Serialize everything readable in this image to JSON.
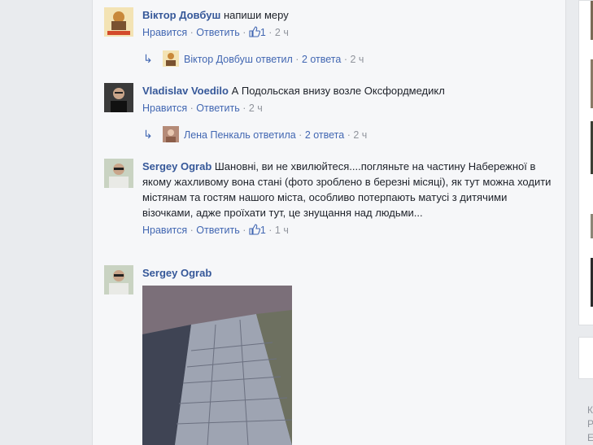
{
  "comments": [
    {
      "author": "Віктор Довбуш",
      "text": "напиши меру",
      "like_label": "Нравится",
      "reply_label": "Ответить",
      "likes": "1",
      "time": "2 ч",
      "replies": {
        "text": "Віктор Довбуш ответил",
        "count": "2 ответа",
        "time": "2 ч"
      }
    },
    {
      "author": "Vladislav Voedilo",
      "text": "А Подольская внизу возле Оксфордмедикл",
      "like_label": "Нравится",
      "reply_label": "Ответить",
      "time": "2 ч",
      "replies": {
        "text": "Лена Пенкаль ответила",
        "count": "2 ответа",
        "time": "2 ч"
      }
    },
    {
      "author": "Sergey Ograb",
      "text": "Шановні, ви не хвилюйтеся....погляньте на частину Набережної в якому жахливому вона стані (фото зроблено в березні місяці), як тут можна ходити містянам та гостям нашого міста, особливо потерпають матусі з дитячими візочками, адже проїхати тут, це знущання над людьми...",
      "like_label": "Нравится",
      "reply_label": "Ответить",
      "likes": "1",
      "time": "1 ч"
    },
    {
      "author": "Sergey Ograb"
    }
  ],
  "icons": {
    "like": "thumbs-up-icon",
    "reply_arrow": "reply-arrow-icon"
  },
  "colors": {
    "link": "#365899",
    "action": "#4267b2",
    "meta": "#90949c",
    "bg": "#f6f7f9"
  },
  "right_column": {
    "lines": [
      "К",
      "Р",
      "Е"
    ]
  }
}
